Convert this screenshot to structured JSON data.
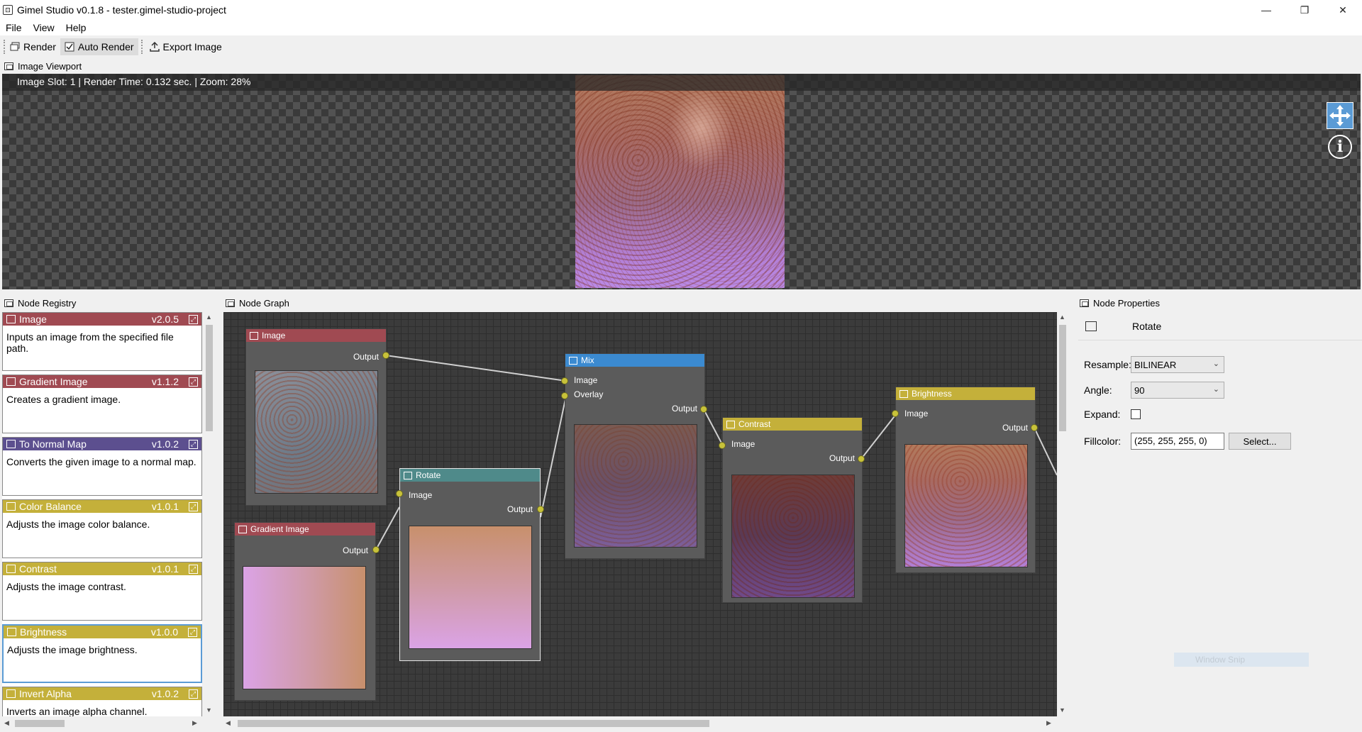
{
  "window": {
    "title": "Gimel Studio v0.1.8 - tester.gimel-studio-project",
    "app_icon_glyph": "⊡",
    "controls": {
      "minimize": "—",
      "maximize": "❐",
      "close": "✕"
    }
  },
  "menu": [
    "File",
    "View",
    "Help"
  ],
  "toolbar": {
    "render_label": "Render",
    "auto_render_label": "Auto Render",
    "export_label": "Export Image",
    "auto_render_checked": true
  },
  "viewport": {
    "title": "Image Viewport",
    "status": "Image Slot: 1 | Render Time: 0.132 sec. | Zoom: 28%",
    "move_icon": "move-icon",
    "info_icon": "info-icon"
  },
  "registry": {
    "title": "Node Registry",
    "items": [
      {
        "name": "Image",
        "version": "v2.0.5",
        "desc": "Inputs an image from the specified file path.",
        "color": "#a04a52"
      },
      {
        "name": "Gradient Image",
        "version": "v1.1.2",
        "desc": "Creates a gradient image.",
        "color": "#a04a52"
      },
      {
        "name": "To Normal Map",
        "version": "v1.0.2",
        "desc": "Converts the given image to a normal map.",
        "color": "#5c4f8f"
      },
      {
        "name": "Color Balance",
        "version": "v1.0.1",
        "desc": "Adjusts the image color balance.",
        "color": "#c4b03a"
      },
      {
        "name": "Contrast",
        "version": "v1.0.1",
        "desc": "Adjusts the image contrast.",
        "color": "#c4b03a"
      },
      {
        "name": "Brightness",
        "version": "v1.0.0",
        "desc": "Adjusts the image brightness.",
        "color": "#c4b03a"
      },
      {
        "name": "Invert Alpha",
        "version": "v1.0.2",
        "desc": "Inverts an image alpha channel.",
        "color": "#c4b03a"
      }
    ]
  },
  "graph": {
    "title": "Node Graph",
    "nodes": {
      "image": {
        "title": "Image",
        "output": "Output",
        "color": "#a04a52"
      },
      "gradient": {
        "title": "Gradient Image",
        "output": "Output",
        "color": "#a04a52"
      },
      "rotate": {
        "title": "Rotate",
        "input": "Image",
        "output": "Output",
        "color": "#4f8a8a"
      },
      "mix": {
        "title": "Mix",
        "input1": "Image",
        "input2": "Overlay",
        "output": "Output",
        "color": "#3b8ad0"
      },
      "contrast": {
        "title": "Contrast",
        "input": "Image",
        "output": "Output",
        "color": "#c4b03a"
      },
      "brightness": {
        "title": "Brightness",
        "input": "Image",
        "output": "Output",
        "color": "#c4b03a"
      }
    }
  },
  "properties": {
    "title": "Node Properties",
    "node_name": "Rotate",
    "resample_label": "Resample:",
    "resample_value": "BILINEAR",
    "angle_label": "Angle:",
    "angle_value": "90",
    "expand_label": "Expand:",
    "expand_checked": false,
    "fillcolor_label": "Fillcolor:",
    "fillcolor_value": "(255, 255, 255, 0)",
    "select_button": "Select..."
  },
  "overlay": {
    "ghost_text": "Window Snip"
  }
}
